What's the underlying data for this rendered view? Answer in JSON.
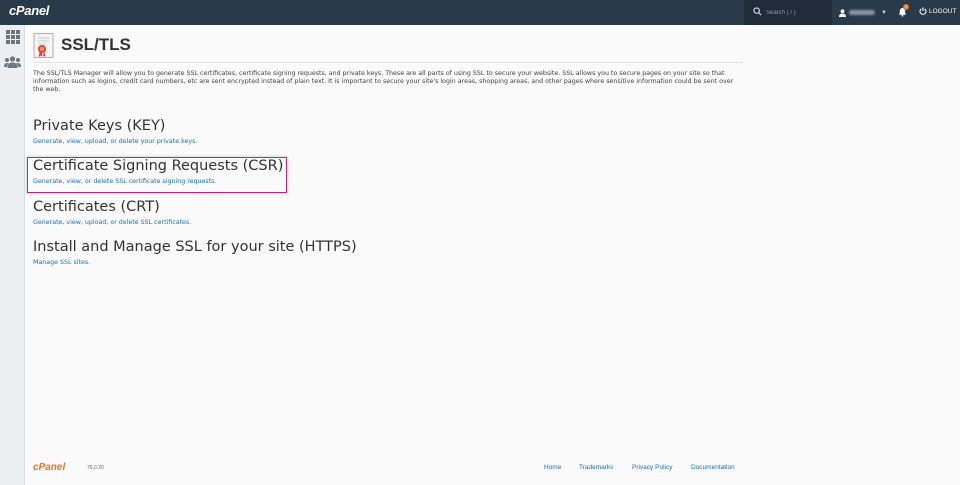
{
  "topbar": {
    "logo": "cPanel",
    "search_placeholder": "Search ( / )",
    "notification_count": "2",
    "logout_label": "LOGOUT"
  },
  "page": {
    "title": "SSL/TLS",
    "description": "The SSL/TLS Manager will allow you to generate SSL certificates, certificate signing requests, and private keys. These are all parts of using SSL to secure your website. SSL allows you to secure pages on your site so that information such as logins, credit card numbers, etc are sent encrypted instead of plain text. It is important to secure your site's login areas, shopping areas, and other pages where sensitive information could be sent over the web."
  },
  "sections": [
    {
      "title": "Private Keys (KEY)",
      "link": "Generate, view, upload, or delete your private keys."
    },
    {
      "title": "Certificate Signing Requests (CSR)",
      "link": "Generate, view, or delete SSL certificate signing requests."
    },
    {
      "title": "Certificates (CRT)",
      "link": "Generate, view, upload, or delete SSL certificates."
    },
    {
      "title": "Install and Manage SSL for your site (HTTPS)",
      "link": "Manage SSL sites."
    }
  ],
  "footer": {
    "logo": "cPanel",
    "version": "76.0.20",
    "links": [
      "Home",
      "Trademarks",
      "Privacy Policy",
      "Documentation"
    ]
  },
  "colors": {
    "topbar": "#293a4a",
    "link": "#1a6fb5",
    "highlight": "#c0277b",
    "brand_orange": "#e8752a"
  },
  "icons": [
    "search-icon",
    "user-icon",
    "bell-icon",
    "logout-icon",
    "grid-icon",
    "users-icon",
    "certificate-icon"
  ]
}
